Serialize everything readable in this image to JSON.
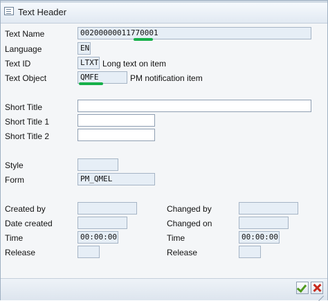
{
  "dialog": {
    "title": "Text Header",
    "icon": "document-icon"
  },
  "header": {
    "text_name_label": "Text Name",
    "text_name_value": "00200000011770001",
    "language_label": "Language",
    "language_value": "EN",
    "text_id_label": "Text ID",
    "text_id_value": "LTXT",
    "text_id_desc": "Long text on item",
    "text_object_label": "Text Object",
    "text_object_value": "QMFE",
    "text_object_desc": "PM notification item"
  },
  "titles": {
    "short_title_label": "Short Title",
    "short_title_value": "",
    "short_title_1_label": "Short Title 1",
    "short_title_1_value": "",
    "short_title_2_label": "Short Title 2",
    "short_title_2_value": ""
  },
  "layout_info": {
    "style_label": "Style",
    "style_value": "",
    "form_label": "Form",
    "form_value": "PM_QMEL"
  },
  "admin": {
    "created_by_label": "Created by",
    "created_by_value": "",
    "date_created_label": "Date created",
    "date_created_value": "",
    "time_label": "Time",
    "time_value": "00:00:00",
    "release_label": "Release",
    "release_value": "",
    "changed_by_label": "Changed by",
    "changed_by_value": "",
    "changed_on_label": "Changed on",
    "changed_on_value": "",
    "changed_time_label": "Time",
    "changed_time_value": "00:00:00",
    "changed_release_label": "Release",
    "changed_release_value": ""
  },
  "buttons": {
    "confirm_icon": "checkmark-icon",
    "cancel_icon": "cancel-icon"
  },
  "colors": {
    "highlight_mark": "#17b04a",
    "confirm": "#4f9a1d",
    "cancel": "#c82a1e"
  }
}
